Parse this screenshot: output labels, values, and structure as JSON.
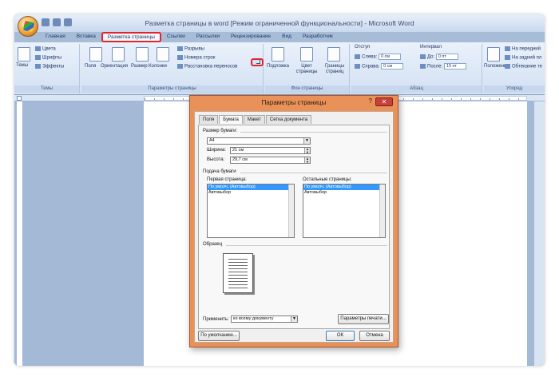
{
  "window": {
    "title": "Разметка страницы в word [Режим ограниченной функциональности] - Microsoft Word"
  },
  "tabs": [
    {
      "label": "Главная"
    },
    {
      "label": "Вставка"
    },
    {
      "label": "Разметка страницы",
      "active": true
    },
    {
      "label": "Ссылки"
    },
    {
      "label": "Рассылки"
    },
    {
      "label": "Рецензирование"
    },
    {
      "label": "Вид"
    },
    {
      "label": "Разработчик"
    }
  ],
  "ribbon": {
    "themes": {
      "group_label": "Темы",
      "big_button": "Темы",
      "items": [
        "Цвета",
        "Шрифты",
        "Эффекты"
      ]
    },
    "page_setup": {
      "group_label": "Параметры страницы",
      "buttons": [
        "Поля",
        "Ориентация",
        "Размер",
        "Колонки"
      ],
      "items": [
        "Разрывы",
        "Номера строк",
        "Расстановка переносов"
      ]
    },
    "page_background": {
      "group_label": "Фон страницы",
      "buttons": [
        "Подложка",
        "Цвет страницы",
        "Границы страниц"
      ]
    },
    "paragraph": {
      "group_label": "Абзац",
      "indent_label": "Отступ",
      "left_label": "Слева:",
      "left_value": "0 см",
      "right_label": "Справа:",
      "right_value": "0 см",
      "spacing_label": "Интервал",
      "before_label": "До:",
      "before_value": "0 пт",
      "after_label": "После:",
      "after_value": "10 пт"
    },
    "arrange": {
      "group_label": "Упоряд",
      "button": "Положение",
      "items": [
        "На передний",
        "На задний пл",
        "Обтекание те"
      ]
    }
  },
  "dialog": {
    "title": "Параметры страницы",
    "help": "?",
    "close": "✕",
    "tabs": [
      "Поля",
      "Бумага",
      "Макет",
      "Сетка документа"
    ],
    "active_tab": "Бумага",
    "paper_size_label": "Размер бумаги:",
    "paper_size_value": "A4",
    "width_label": "Ширина:",
    "width_value": "21 см",
    "height_label": "Высота:",
    "height_value": "29,7 см",
    "paper_source_label": "Подача бумаги",
    "first_page_label": "Первая страница:",
    "first_page_items": [
      "По умолч. (Автовыбор)",
      "Автовыбор"
    ],
    "other_pages_label": "Остальные страницы:",
    "other_pages_items": [
      "По умолч. (Автовыбор)",
      "Автовыбор"
    ],
    "preview_label": "Образец",
    "apply_label": "Применить:",
    "apply_value": "ко всему документу",
    "print_options_button": "Параметры печати...",
    "default_button": "По умолчанию...",
    "ok_button": "ОК",
    "cancel_button": "Отмена"
  }
}
